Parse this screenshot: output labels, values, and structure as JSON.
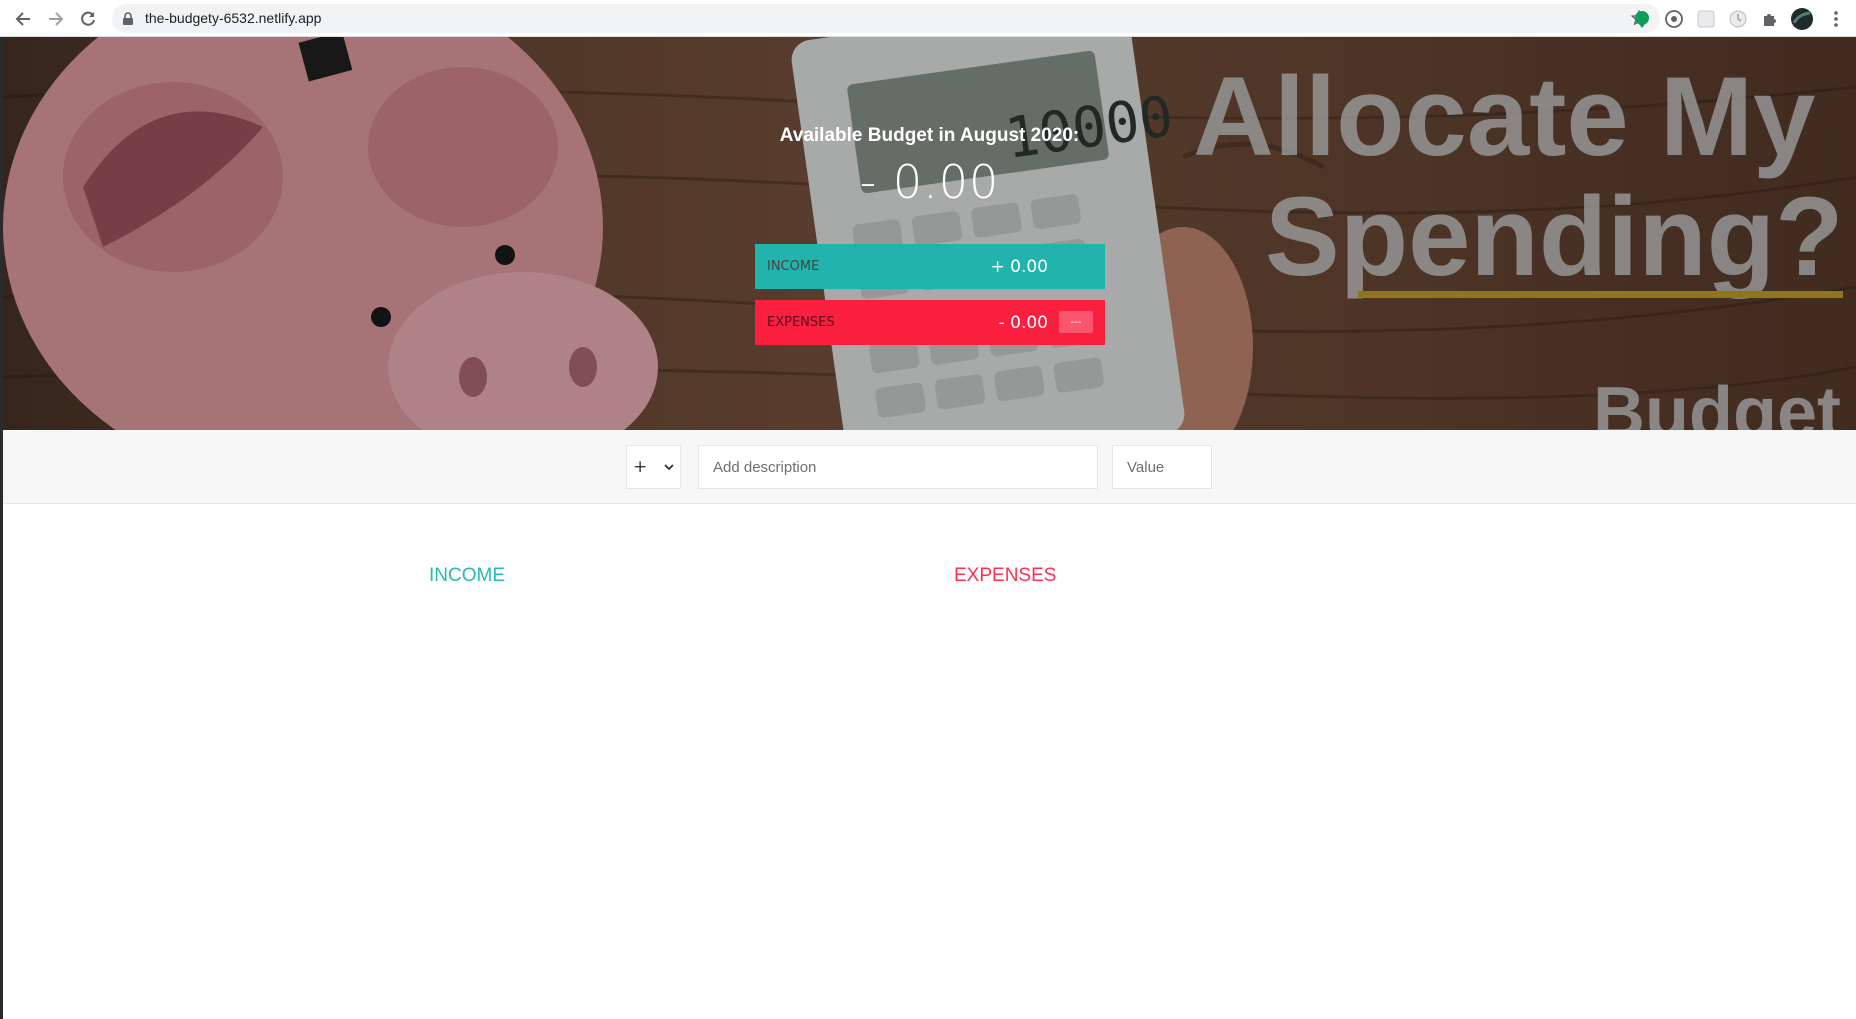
{
  "browser": {
    "url": "the-budgety-6532.netlify.app",
    "icons": [
      "back-icon",
      "forward-icon",
      "reload-icon",
      "lock-icon",
      "star-icon",
      "extension-icons",
      "profile-avatar",
      "menu-icon"
    ]
  },
  "hero": {
    "title": "Available Budget in August 2020:",
    "value": "- 0.00",
    "income": {
      "label": "INCOME",
      "value": "+ 0.00"
    },
    "expenses": {
      "label": "EXPENSES",
      "value": "- 0.00",
      "percentage": "---"
    },
    "background_text": {
      "line1": "Allocate My",
      "line2": "Spending?",
      "line3": "Budget",
      "calculator_display": "10000"
    }
  },
  "add": {
    "type_value": "+",
    "description_placeholder": "Add description",
    "value_placeholder": "Value"
  },
  "lists": {
    "income_title": "INCOME",
    "expenses_title": "EXPENSES"
  },
  "colors": {
    "income": "#28b9b5",
    "expenses": "#ff2f4f"
  }
}
